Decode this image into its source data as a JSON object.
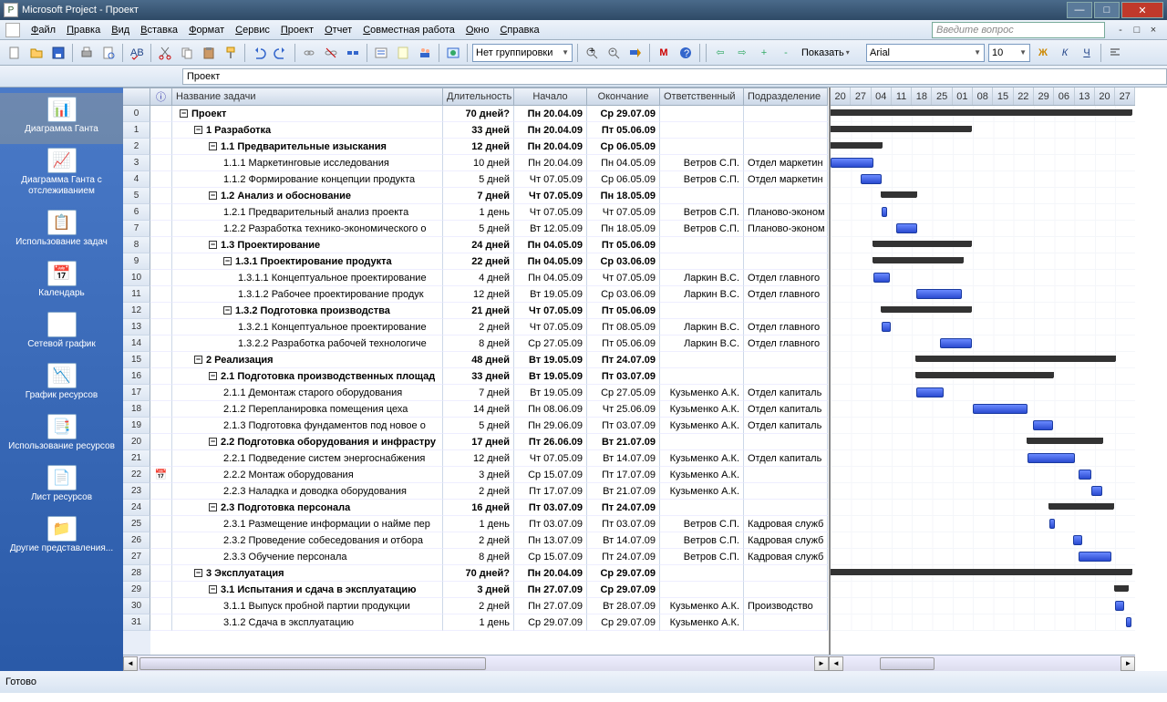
{
  "title": "Microsoft Project - Проект",
  "menu": [
    "Файл",
    "Правка",
    "Вид",
    "Вставка",
    "Формат",
    "Сервис",
    "Проект",
    "Отчет",
    "Совместная работа",
    "Окно",
    "Справка"
  ],
  "ask_placeholder": "Введите вопрос",
  "grouping": "Нет группировки",
  "show_label": "Показать",
  "font_name": "Arial",
  "font_size": "10",
  "entry_value": "Проект",
  "sidebar": [
    {
      "id": "gantt",
      "label": "Диаграмма Ганта"
    },
    {
      "id": "track",
      "label": "Диаграмма Ганта с отслеживанием"
    },
    {
      "id": "taskuse",
      "label": "Использование задач"
    },
    {
      "id": "calendar",
      "label": "Календарь"
    },
    {
      "id": "network",
      "label": "Сетевой график"
    },
    {
      "id": "resgraph",
      "label": "График ресурсов"
    },
    {
      "id": "resuse",
      "label": "Использование ресурсов"
    },
    {
      "id": "ressheet",
      "label": "Лист ресурсов"
    },
    {
      "id": "other",
      "label": "Другие представления..."
    }
  ],
  "columns": {
    "name": "Название задачи",
    "dur": "Длительность",
    "start": "Начало",
    "end": "Окончание",
    "resp": "Ответственный",
    "dept": "Подразделение"
  },
  "info_icon": "ⓘ",
  "timeline": [
    "20",
    "27",
    "04",
    "11",
    "18",
    "25",
    "01",
    "08",
    "15",
    "22",
    "29",
    "06",
    "13",
    "20",
    "27"
  ],
  "rows": [
    {
      "n": 0,
      "lvl": 0,
      "sum": true,
      "name": "Проект",
      "dur": "70 дней?",
      "start": "Пн 20.04.09",
      "end": "Ср 29.07.09",
      "resp": "",
      "dept": "",
      "g": [
        0,
        330,
        "s"
      ]
    },
    {
      "n": 1,
      "lvl": 1,
      "sum": true,
      "name": "1 Разработка",
      "dur": "33 дней",
      "start": "Пн 20.04.09",
      "end": "Пт 05.06.09",
      "resp": "",
      "dept": "",
      "g": [
        0,
        154,
        "s"
      ]
    },
    {
      "n": 2,
      "lvl": 2,
      "sum": true,
      "name": "1.1 Предварительные изыскания",
      "dur": "12 дней",
      "start": "Пн 20.04.09",
      "end": "Ср 06.05.09",
      "resp": "",
      "dept": "",
      "g": [
        0,
        56,
        "s"
      ]
    },
    {
      "n": 3,
      "lvl": 3,
      "sum": false,
      "name": "1.1.1 Маркетинговые исследования",
      "dur": "10 дней",
      "start": "Пн 20.04.09",
      "end": "Пн 04.05.09",
      "resp": "Ветров С.П.",
      "dept": "Отдел маркетин",
      "g": [
        0,
        47,
        "t"
      ]
    },
    {
      "n": 4,
      "lvl": 3,
      "sum": false,
      "name": "1.1.2 Формирование концепции продукта",
      "dur": "5 дней",
      "start": "Чт 07.05.09",
      "end": "Ср 06.05.09",
      "resp": "Ветров С.П.",
      "dept": "Отдел маркетин",
      "g": [
        33,
        23,
        "t"
      ]
    },
    {
      "n": 5,
      "lvl": 2,
      "sum": true,
      "name": "1.2 Анализ и обоснование",
      "dur": "7 дней",
      "start": "Чт 07.05.09",
      "end": "Пн 18.05.09",
      "resp": "",
      "dept": "",
      "g": [
        56,
        38,
        "s"
      ]
    },
    {
      "n": 6,
      "lvl": 3,
      "sum": false,
      "name": "1.2.1 Предварительный анализ проекта",
      "dur": "1 день",
      "start": "Чт 07.05.09",
      "end": "Чт 07.05.09",
      "resp": "Ветров С.П.",
      "dept": "Планово-эконом",
      "g": [
        56,
        6,
        "t"
      ]
    },
    {
      "n": 7,
      "lvl": 3,
      "sum": false,
      "name": "1.2.2 Разработка технико-экономического о",
      "dur": "5 дней",
      "start": "Вт 12.05.09",
      "end": "Пн 18.05.09",
      "resp": "Ветров С.П.",
      "dept": "Планово-эконом",
      "g": [
        72,
        23,
        "t"
      ]
    },
    {
      "n": 8,
      "lvl": 2,
      "sum": true,
      "name": "1.3 Проектирование",
      "dur": "24 дней",
      "start": "Пн 04.05.09",
      "end": "Пт 05.06.09",
      "resp": "",
      "dept": "",
      "g": [
        47,
        107,
        "s"
      ]
    },
    {
      "n": 9,
      "lvl": 3,
      "sum": true,
      "name": "1.3.1 Проектирование продукта",
      "dur": "22 дней",
      "start": "Пн 04.05.09",
      "end": "Ср 03.06.09",
      "resp": "",
      "dept": "",
      "g": [
        47,
        98,
        "s"
      ]
    },
    {
      "n": 10,
      "lvl": 4,
      "sum": false,
      "name": "1.3.1.1 Концептуальное проектирование",
      "dur": "4 дней",
      "start": "Пн 04.05.09",
      "end": "Чт 07.05.09",
      "resp": "Ларкин В.С.",
      "dept": "Отдел главного",
      "g": [
        47,
        18,
        "t"
      ]
    },
    {
      "n": 11,
      "lvl": 4,
      "sum": false,
      "name": "1.3.1.2 Рабочее проектирование продук",
      "dur": "12 дней",
      "start": "Вт 19.05.09",
      "end": "Ср 03.06.09",
      "resp": "Ларкин В.С.",
      "dept": "Отдел главного",
      "g": [
        94,
        50,
        "t"
      ]
    },
    {
      "n": 12,
      "lvl": 3,
      "sum": true,
      "name": "1.3.2 Подготовка производства",
      "dur": "21 дней",
      "start": "Чт 07.05.09",
      "end": "Пт 05.06.09",
      "resp": "",
      "dept": "",
      "g": [
        56,
        98,
        "s"
      ]
    },
    {
      "n": 13,
      "lvl": 4,
      "sum": false,
      "name": "1.3.2.1 Концептуальное проектирование",
      "dur": "2 дней",
      "start": "Чт 07.05.09",
      "end": "Пт 08.05.09",
      "resp": "Ларкин В.С.",
      "dept": "Отдел главного",
      "g": [
        56,
        10,
        "t"
      ]
    },
    {
      "n": 14,
      "lvl": 4,
      "sum": false,
      "name": "1.3.2.2 Разработка рабочей технологиче",
      "dur": "8 дней",
      "start": "Ср 27.05.09",
      "end": "Пт 05.06.09",
      "resp": "Ларкин В.С.",
      "dept": "Отдел главного",
      "g": [
        120,
        35,
        "t"
      ]
    },
    {
      "n": 15,
      "lvl": 1,
      "sum": true,
      "name": "2 Реализация",
      "dur": "48 дней",
      "start": "Вт 19.05.09",
      "end": "Пт 24.07.09",
      "resp": "",
      "dept": "",
      "g": [
        94,
        218,
        "s"
      ]
    },
    {
      "n": 16,
      "lvl": 2,
      "sum": true,
      "name": "2.1 Подготовка производственных площад",
      "dur": "33 дней",
      "start": "Вт 19.05.09",
      "end": "Пт 03.07.09",
      "resp": "",
      "dept": "",
      "g": [
        94,
        150,
        "s"
      ]
    },
    {
      "n": 17,
      "lvl": 3,
      "sum": false,
      "name": "2.1.1 Демонтаж старого оборудования",
      "dur": "7 дней",
      "start": "Вт 19.05.09",
      "end": "Ср 27.05.09",
      "resp": "Кузьменко А.К.",
      "dept": "Отдел капиталь",
      "g": [
        94,
        30,
        "t"
      ]
    },
    {
      "n": 18,
      "lvl": 3,
      "sum": false,
      "name": "2.1.2 Перепланировка помещения цеха",
      "dur": "14 дней",
      "start": "Пн 08.06.09",
      "end": "Чт 25.06.09",
      "resp": "Кузьменко А.К.",
      "dept": "Отдел капиталь",
      "g": [
        156,
        60,
        "t"
      ]
    },
    {
      "n": 19,
      "lvl": 3,
      "sum": false,
      "name": "2.1.3 Подготовка фундаментов под новое о",
      "dur": "5 дней",
      "start": "Пн 29.06.09",
      "end": "Пт 03.07.09",
      "resp": "Кузьменко А.К.",
      "dept": "Отдел капиталь",
      "g": [
        222,
        22,
        "t"
      ]
    },
    {
      "n": 20,
      "lvl": 2,
      "sum": true,
      "name": "2.2 Подготовка оборудования и инфрастру",
      "dur": "17 дней",
      "start": "Пт 26.06.09",
      "end": "Вт 21.07.09",
      "resp": "",
      "dept": "",
      "g": [
        216,
        82,
        "s"
      ]
    },
    {
      "n": 21,
      "lvl": 3,
      "sum": false,
      "name": "2.2.1 Подведение систем энергоснабжения",
      "dur": "12 дней",
      "start": "Чт 07.05.09",
      "end": "Вт 14.07.09",
      "resp": "Кузьменко А.К.",
      "dept": "Отдел капиталь",
      "g": [
        216,
        52,
        "t"
      ]
    },
    {
      "n": 22,
      "lvl": 3,
      "sum": false,
      "name": "2.2.2 Монтаж оборудования",
      "dur": "3 дней",
      "start": "Ср 15.07.09",
      "end": "Пт 17.07.09",
      "resp": "Кузьменко А.К.",
      "dept": "",
      "g": [
        272,
        14,
        "t"
      ],
      "ind": "📅"
    },
    {
      "n": 23,
      "lvl": 3,
      "sum": false,
      "name": "2.2.3 Наладка и доводка оборудования",
      "dur": "2 дней",
      "start": "Пт 17.07.09",
      "end": "Вт 21.07.09",
      "resp": "Кузьменко А.К.",
      "dept": "",
      "g": [
        286,
        12,
        "t"
      ]
    },
    {
      "n": 24,
      "lvl": 2,
      "sum": true,
      "name": "2.3 Подготовка персонала",
      "dur": "16 дней",
      "start": "Пт 03.07.09",
      "end": "Пт 24.07.09",
      "resp": "",
      "dept": "",
      "g": [
        240,
        70,
        "s"
      ]
    },
    {
      "n": 25,
      "lvl": 3,
      "sum": false,
      "name": "2.3.1 Размещение информации о найме пер",
      "dur": "1 день",
      "start": "Пт 03.07.09",
      "end": "Пт 03.07.09",
      "resp": "Ветров С.П.",
      "dept": "Кадровая служб",
      "g": [
        240,
        6,
        "t"
      ]
    },
    {
      "n": 26,
      "lvl": 3,
      "sum": false,
      "name": "2.3.2 Проведение собеседования и отбора",
      "dur": "2 дней",
      "start": "Пн 13.07.09",
      "end": "Вт 14.07.09",
      "resp": "Ветров С.П.",
      "dept": "Кадровая служб",
      "g": [
        266,
        10,
        "t"
      ]
    },
    {
      "n": 27,
      "lvl": 3,
      "sum": false,
      "name": "2.3.3 Обучение персонала",
      "dur": "8 дней",
      "start": "Ср 15.07.09",
      "end": "Пт 24.07.09",
      "resp": "Ветров С.П.",
      "dept": "Кадровая служб",
      "g": [
        272,
        36,
        "t"
      ]
    },
    {
      "n": 28,
      "lvl": 1,
      "sum": true,
      "name": "3 Эксплуатация",
      "dur": "70 дней?",
      "start": "Пн 20.04.09",
      "end": "Ср 29.07.09",
      "resp": "",
      "dept": "",
      "g": [
        0,
        330,
        "s"
      ]
    },
    {
      "n": 29,
      "lvl": 2,
      "sum": true,
      "name": "3.1 Испытания и сдача в эксплуатацию",
      "dur": "3 дней",
      "start": "Пн 27.07.09",
      "end": "Ср 29.07.09",
      "resp": "",
      "dept": "",
      "g": [
        312,
        14,
        "s"
      ]
    },
    {
      "n": 30,
      "lvl": 3,
      "sum": false,
      "name": "3.1.1 Выпуск пробной партии продукции",
      "dur": "2 дней",
      "start": "Пн 27.07.09",
      "end": "Вт 28.07.09",
      "resp": "Кузьменко А.К.",
      "dept": "Производство",
      "g": [
        312,
        10,
        "t"
      ]
    },
    {
      "n": 31,
      "lvl": 3,
      "sum": false,
      "name": "3.1.2 Сдача в эксплуатацию",
      "dur": "1 день",
      "start": "Ср 29.07.09",
      "end": "Ср 29.07.09",
      "resp": "Кузьменко А.К.",
      "dept": "",
      "g": [
        324,
        6,
        "t"
      ]
    }
  ],
  "status": "Готово"
}
